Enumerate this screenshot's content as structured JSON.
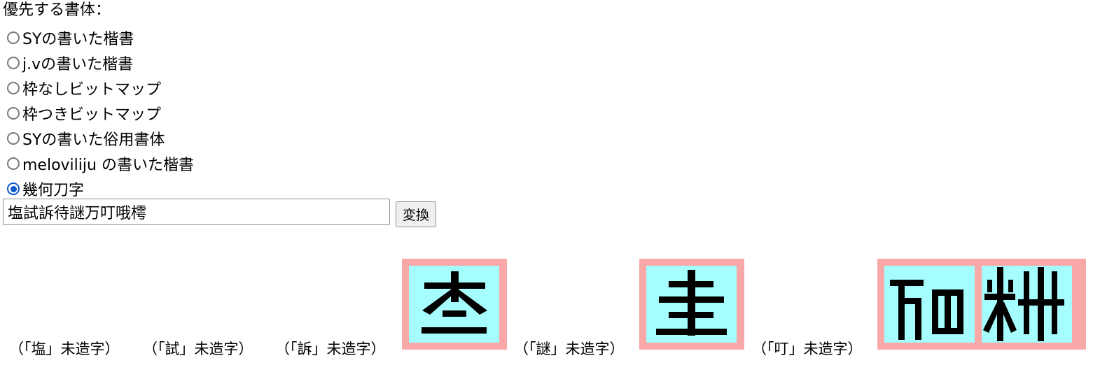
{
  "heading": "優先する書体：",
  "font_options": [
    {
      "label": "SYの書いた楷書",
      "checked": false
    },
    {
      "label": "j.vの書いた楷書",
      "checked": false
    },
    {
      "label": "枠なしビットマップ",
      "checked": false
    },
    {
      "label": "枠つきビットマップ",
      "checked": false
    },
    {
      "label": "SYの書いた俗用書体",
      "checked": false
    },
    {
      "label": "meloviliju の書いた楷書",
      "checked": false
    },
    {
      "label": "幾何刀字",
      "checked": true
    }
  ],
  "input": {
    "value": "塩試訴待謎万叮哦樗"
  },
  "convert_button": "変換",
  "output": {
    "notes": [
      "（「塩」未造字）",
      "（「試」未造字）",
      "（「訴」未造字）",
      "（「謎」未造字）",
      "（「叮」未造字）"
    ]
  },
  "colors": {
    "glyph_frame": "#f9a8a8",
    "glyph_background": "#a6fdfd",
    "radio_accent": "#0b57d0"
  }
}
